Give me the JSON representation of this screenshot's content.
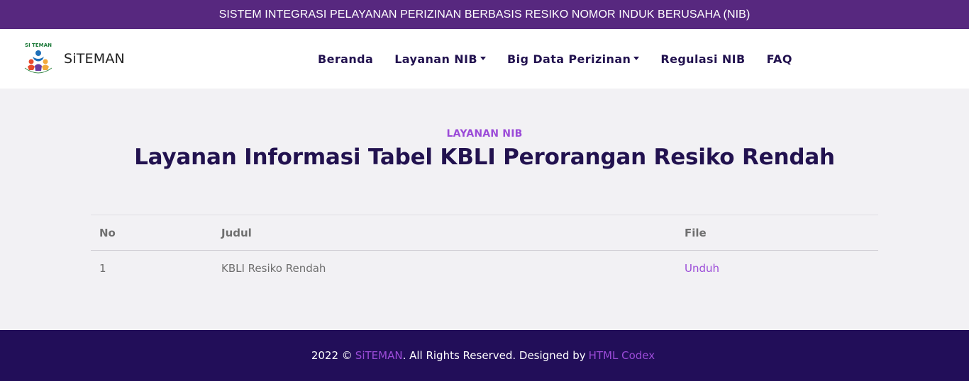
{
  "topbar": {
    "text": "SISTEM INTEGRASI PELAYANAN PERIZINAN BERBASIS RESIKO NOMOR INDUK BERUSAHA (NIB)"
  },
  "brand": {
    "logo_text": "SI TEMAN",
    "name": "SiTEMAN"
  },
  "nav": {
    "items": [
      {
        "label": "Beranda",
        "dropdown": false
      },
      {
        "label": "Layanan NIB",
        "dropdown": true
      },
      {
        "label": "Big Data Perizinan",
        "dropdown": true
      },
      {
        "label": "Regulasi NIB",
        "dropdown": false
      },
      {
        "label": "FAQ",
        "dropdown": false
      }
    ]
  },
  "section": {
    "subtitle": "LAYANAN NIB",
    "title": "Layanan Informasi Tabel KBLI Perorangan Resiko Rendah"
  },
  "table": {
    "headers": [
      "No",
      "Judul",
      "File"
    ],
    "rows": [
      {
        "no": "1",
        "judul": "KBLI Resiko Rendah",
        "file": "Unduh"
      }
    ]
  },
  "footer": {
    "year_copy": "2022 ©",
    "brand_link": "SiTEMAN",
    "rights": ". All Rights Reserved. Designed by",
    "designer_link": "HTML Codex"
  },
  "colors": {
    "topbar": "#57287f",
    "nav_text": "#22124f",
    "accent": "#9b4bd8",
    "footer": "#220e59",
    "background": "#f2f1f4"
  }
}
